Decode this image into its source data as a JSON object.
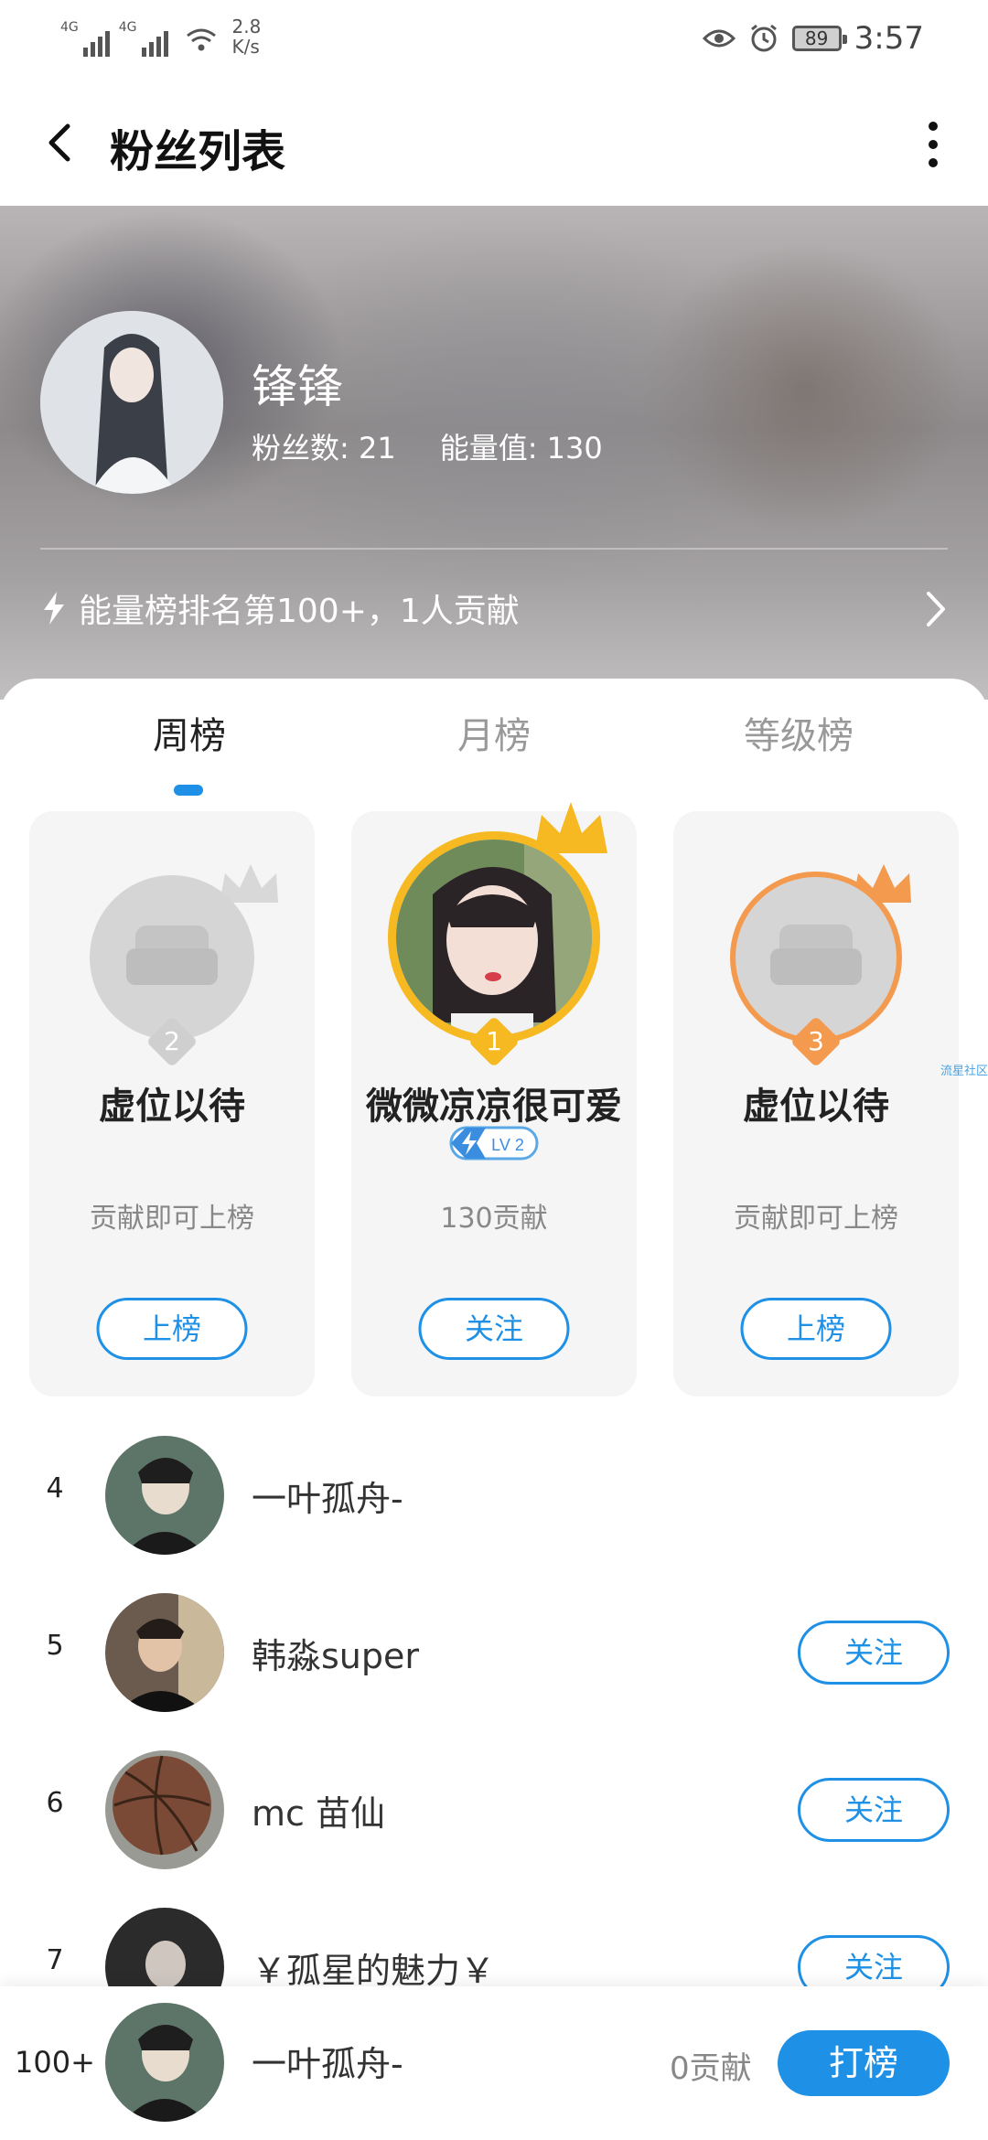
{
  "status_bar": {
    "signal1": "4G",
    "signal2": "4G",
    "speed_value": "2.8",
    "speed_unit": "K/s",
    "battery": "89",
    "time": "3:57"
  },
  "appbar": {
    "title": "粉丝列表"
  },
  "profile": {
    "name": "锋锋",
    "fans": "粉丝数: 21",
    "energy": "能量值: 130",
    "rank_text": "能量榜排名第100+，1人贡献"
  },
  "tabs": [
    {
      "label": "周榜",
      "active": true
    },
    {
      "label": "月榜",
      "active": false
    },
    {
      "label": "等级榜",
      "active": false
    }
  ],
  "podium": {
    "second": {
      "rank": "2",
      "name": "虚位以待",
      "sub": "贡献即可上榜",
      "button": "上榜"
    },
    "first": {
      "rank": "1",
      "name": "微微凉凉很可爱",
      "level": "LV 2",
      "sub": "130贡献",
      "button": "关注"
    },
    "third": {
      "rank": "3",
      "name": "虚位以待",
      "sub": "贡献即可上榜",
      "button": "上榜"
    }
  },
  "side_note": "流星社区",
  "list": [
    {
      "rank": "4",
      "name": "一叶孤舟-",
      "button": ""
    },
    {
      "rank": "5",
      "name": "韩淼super",
      "button": "关注"
    },
    {
      "rank": "6",
      "name": "mc 苗仙",
      "button": "关注"
    },
    {
      "rank": "7",
      "name": "￥孤星的魅力￥",
      "button": "关注"
    }
  ],
  "bottom": {
    "rank": "100+",
    "name": "一叶孤舟-",
    "contribution": "0贡献",
    "button": "打榜"
  },
  "colors": {
    "accent": "#1e90e6",
    "gold": "#f6b921",
    "bronze": "#f39a4e"
  }
}
